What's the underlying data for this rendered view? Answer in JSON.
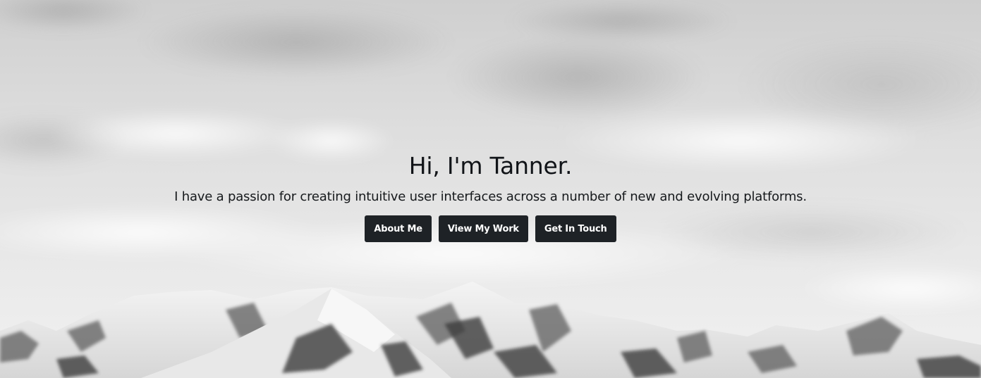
{
  "hero": {
    "title": "Hi, I'm Tanner.",
    "tagline": "I have a passion for creating intuitive user interfaces across a number of new and evolving platforms.",
    "buttons": [
      {
        "label": "About Me"
      },
      {
        "label": "View My Work"
      },
      {
        "label": "Get In Touch"
      }
    ],
    "colors": {
      "button_bg": "#1e2226",
      "button_text": "#ffffff",
      "text": "#111418"
    }
  }
}
